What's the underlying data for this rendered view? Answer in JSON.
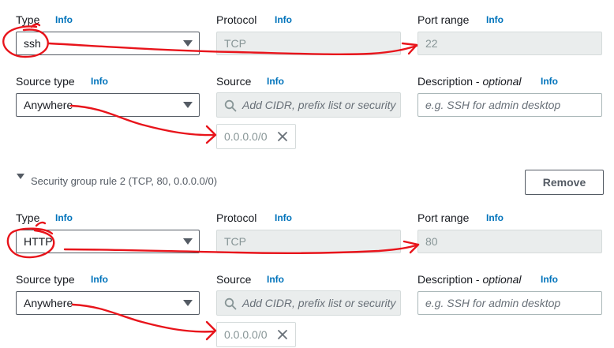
{
  "rule1": {
    "type_label": "Type",
    "type_info": "Info",
    "type_value": "ssh",
    "protocol_label": "Protocol",
    "protocol_info": "Info",
    "protocol_value": "TCP",
    "port_label": "Port range",
    "port_info": "Info",
    "port_value": "22",
    "source_type_label": "Source type",
    "source_type_info": "Info",
    "source_type_value": "Anywhere",
    "source_label": "Source",
    "source_info": "Info",
    "source_placeholder": "Add CIDR, prefix list or security",
    "source_token": "0.0.0.0/0",
    "description_label": "Description - ",
    "description_optional": "optional",
    "description_info": "Info",
    "description_placeholder": "e.g. SSH for admin desktop"
  },
  "rule2": {
    "header": "Security group rule 2 (TCP, 80, 0.0.0.0/0)",
    "remove_label": "Remove",
    "type_label": "Type",
    "type_info": "Info",
    "type_value": "HTTP",
    "protocol_label": "Protocol",
    "protocol_info": "Info",
    "protocol_value": "TCP",
    "port_label": "Port range",
    "port_info": "Info",
    "port_value": "80",
    "source_type_label": "Source type",
    "source_type_info": "Info",
    "source_type_value": "Anywhere",
    "source_label": "Source",
    "source_info": "Info",
    "source_placeholder": "Add CIDR, prefix list or security",
    "source_token": "0.0.0.0/0",
    "description_label": "Description - ",
    "description_optional": "optional",
    "description_info": "Info",
    "description_placeholder": "e.g. SSH for admin desktop"
  },
  "colors": {
    "link": "#0073bb",
    "annotation": "#e8141b",
    "readonly_bg": "#eaeded"
  },
  "icons": [
    "chevron-down-icon",
    "search-icon",
    "close-icon",
    "expand-triangle-icon"
  ]
}
